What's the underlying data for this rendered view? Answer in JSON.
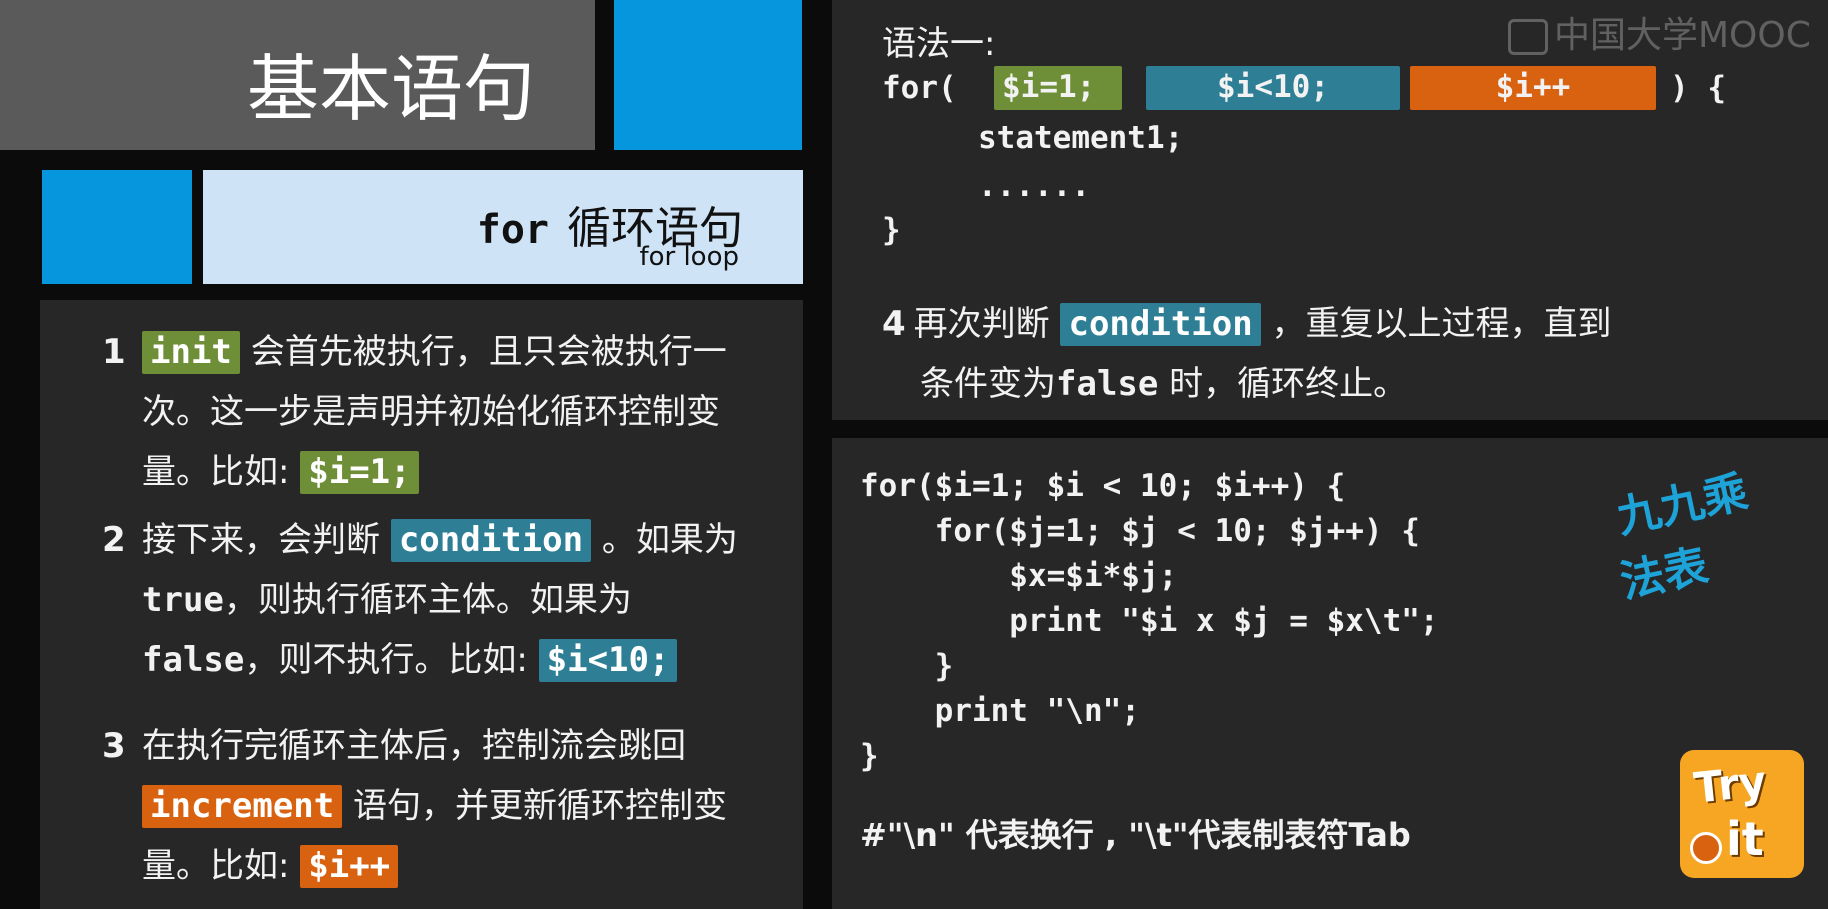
{
  "watermark": "中国大学MOOC",
  "title": "基本语句",
  "subtitle": {
    "keyword": "for",
    "text": "循环语句",
    "english": "for loop"
  },
  "left_items": [
    {
      "num": "1",
      "parts": [
        {
          "type": "tag",
          "color": "green",
          "text": "init"
        },
        {
          "type": "text",
          "text": " 会首先被执行，且只会被执行一次。这一步是声明并初始化循环控制变量。比如: "
        },
        {
          "type": "tag",
          "color": "green",
          "text": "$i=1;"
        }
      ]
    },
    {
      "num": "2",
      "parts": [
        {
          "type": "text",
          "text": "接下来，会判断 "
        },
        {
          "type": "tag",
          "color": "teal",
          "text": "condition"
        },
        {
          "type": "text",
          "text": " 。如果为"
        },
        {
          "type": "mono",
          "text": "true"
        },
        {
          "type": "text",
          "text": "，则执行循环主体。如果为"
        },
        {
          "type": "mono",
          "text": "false"
        },
        {
          "type": "text",
          "text": "，则不执行。比如: "
        },
        {
          "type": "tag",
          "color": "teal",
          "text": "$i<10;"
        }
      ]
    },
    {
      "num": "3",
      "parts": [
        {
          "type": "text",
          "text": "在执行完循环主体后，控制流会跳回 "
        },
        {
          "type": "tag",
          "color": "orange",
          "text": "increment"
        },
        {
          "type": "text",
          "text": " 语句，并更新循环控制变量。比如: "
        },
        {
          "type": "tag",
          "color": "orange",
          "text": "$i++"
        }
      ]
    }
  ],
  "syntax": {
    "label": "语法一:",
    "for_open": "for(",
    "init": "$i=1;",
    "condition": "$i<10;",
    "increment": "$i++",
    "for_close": ") {",
    "body": "statement1;",
    "dots": "......",
    "close_brace": "}"
  },
  "step4": {
    "num": "4",
    "before": "再次判断 ",
    "tag": "condition",
    "after1": " ，重复以上过程，直到",
    "line2_a": "条件变为",
    "line2_mono": "false",
    "line2_b": " 时，循环终止。"
  },
  "example_code": [
    "for($i=1; $i < 10; $i++) {",
    "    for($j=1; $j < 10; $j++) {",
    "        $x=$i*$j;",
    "        print \"$i x $j = $x\\t\";",
    "    }",
    "    print \"\\n\";",
    "}"
  ],
  "comment": "#\"\\n\" 代表换行 , \"\\t\"代表制表符Tab",
  "handwritten": {
    "line1": "九九乘",
    "line2": "法表"
  },
  "badge": {
    "line1": "Try",
    "line2": "it"
  },
  "colors": {
    "green": "#6e8f37",
    "teal": "#2e7f95",
    "orange": "#d96210",
    "blue": "#0596de"
  }
}
